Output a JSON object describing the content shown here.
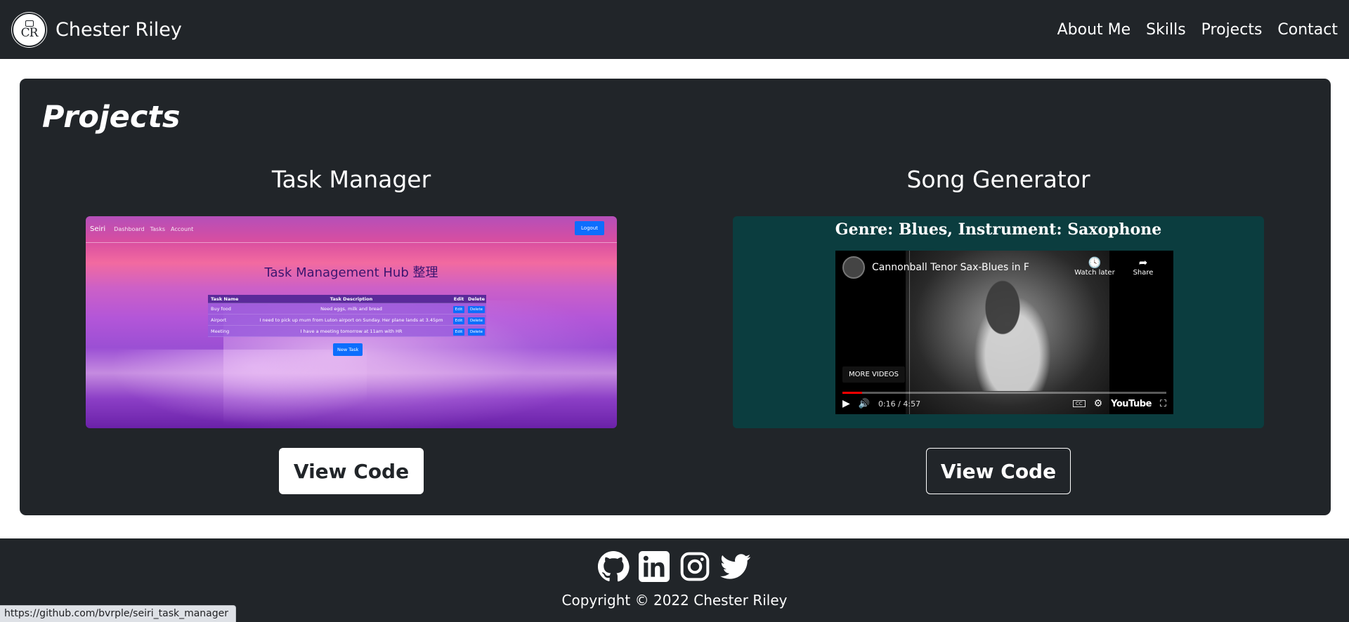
{
  "navbar": {
    "logo_text": "CR",
    "brand": "Chester Riley",
    "links": [
      "About Me",
      "Skills",
      "Projects",
      "Contact"
    ]
  },
  "projects": {
    "heading": "Projects",
    "items": [
      {
        "title": "Task Manager",
        "button": "View Code",
        "screenshot": {
          "brand": "Seiri",
          "nav": [
            "Dashboard",
            "Tasks",
            "Account"
          ],
          "logout": "Logout",
          "hub_title": "Task Management Hub 整理",
          "table_headers": [
            "Task Name",
            "Task Description",
            "Edit",
            "Delete"
          ],
          "rows": [
            {
              "name": "Buy food",
              "desc": "Need eggs, milk and bread"
            },
            {
              "name": "Airport",
              "desc": "I need to pick up mum from Luton airport on Sunday. Her plane lands at 3.45pm"
            },
            {
              "name": "Meeting",
              "desc": "I have a meeting tomorrow at 11am with HR"
            }
          ],
          "edit_label": "Edit",
          "delete_label": "Delete",
          "new_task": "New Task"
        }
      },
      {
        "title": "Song Generator",
        "button": "View Code",
        "screenshot": {
          "genre_line": "Genre: Blues, Instrument: Saxophone",
          "video_title": "Cannonball Tenor Sax-Blues in F",
          "watch_later": "Watch later",
          "share": "Share",
          "more_videos": "MORE VIDEOS",
          "time": "0:16 / 4:57",
          "progress": 0.06,
          "yt_logo": "YouTube"
        }
      }
    ]
  },
  "footer": {
    "socials": [
      "github-icon",
      "linkedin-icon",
      "instagram-icon",
      "twitter-icon"
    ],
    "copyright": "Copyright © 2022 Chester Riley"
  },
  "statusbar": {
    "url": "https://github.com/bvrple/seiri_task_manager"
  }
}
